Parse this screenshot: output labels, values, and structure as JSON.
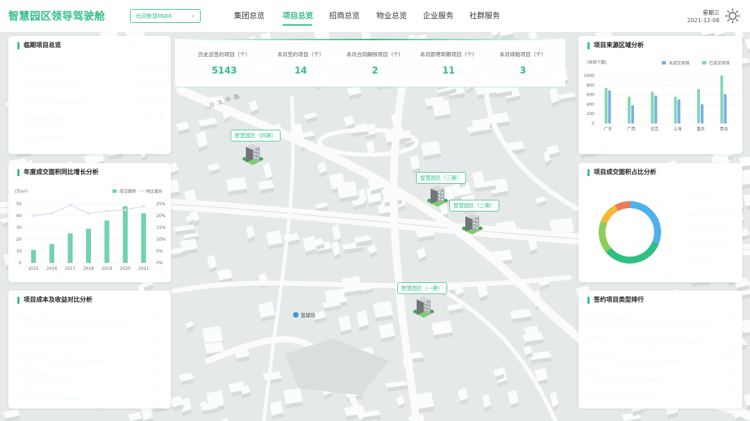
{
  "header": {
    "logo": "智慧园区领导驾驶舱",
    "park_select": "元间智慧PARK",
    "nav": [
      "集团总览",
      "项目总览",
      "招商总览",
      "物业总览",
      "企业服务",
      "社群服务"
    ],
    "nav_active_index": 1,
    "weekday": "星期三",
    "date": "2021-12-08"
  },
  "expiring": {
    "title": "临期项目总览",
    "items": [
      {
        "index": "1",
        "text": "进入意向协议阶段",
        "date": "2021-12-19"
      },
      {
        "index": "2",
        "text": "意向协议已签署，待审批",
        "date": "2021-12-21"
      },
      {
        "index": "3",
        "text": "二次回访，进入意向协议阶...",
        "date": "2021-12-30"
      },
      {
        "index": "4",
        "text": "进入意向协议阶段",
        "date": "2022-1-30"
      },
      {
        "index": "5",
        "text": "进入意向协议阶段",
        "date": "2022-2-14"
      }
    ]
  },
  "annual": {
    "title": "年度成交面积同比增长分析"
  },
  "cost": {
    "title": "项目成本及收益对比分析",
    "items": [
      {
        "name": "智慧园区（一期）",
        "value": "4242",
        "fill": 0.77
      },
      {
        "name": "智慧园区（二期）",
        "value": "3541",
        "fill": 0.47
      },
      {
        "name": "智慧园区（三期）",
        "value": "3894",
        "fill": 0.61
      },
      {
        "name": "智慧园区（四期）",
        "value": "3104",
        "fill": 0.35
      },
      {
        "name": "智慧园区（五期）",
        "value": "2765",
        "fill": 0.43
      }
    ]
  },
  "stats": [
    {
      "label": "历史总签约项目（个）",
      "value": "5143"
    },
    {
      "label": "本月签约项目（个）",
      "value": "14"
    },
    {
      "label": "本月合同解除项目（个）",
      "value": "2"
    },
    {
      "label": "本月即将到期项目（个）",
      "value": "11"
    },
    {
      "label": "本月续租项目（个）",
      "value": "3"
    }
  ],
  "map": {
    "road_name": "沙 太 中 路",
    "poi": "篮球场",
    "labels": [
      "智慧园区（四期）",
      "智慧园区（三期）",
      "智慧园区（二期）",
      "智慧园区（一期）"
    ]
  },
  "source": {
    "title": "项目来源区域分析"
  },
  "share": {
    "title": "项目成交面积占比分析"
  },
  "ranking": {
    "title": "签约项目类型排行",
    "items": [
      {
        "name": "软件与信息技术服务业",
        "value": "1532",
        "fill": 0.86
      },
      {
        "name": "生物医药",
        "value": "1412",
        "fill": 0.78
      },
      {
        "name": "文化创意产业",
        "value": "1105",
        "fill": 0.62
      },
      {
        "name": "时尚产业",
        "value": "897",
        "fill": 0.51
      },
      {
        "name": "数字经济",
        "value": "684",
        "fill": 0.43
      }
    ]
  },
  "chart_data": [
    {
      "type": "bar",
      "title": "年度成交面积同比增长分析",
      "ylabel": "(万m²)",
      "categories": [
        "2015",
        "2016",
        "2017",
        "2018",
        "2019",
        "2020",
        "2021"
      ],
      "series": [
        {
          "name": "成交面积",
          "type": "bar",
          "color": "#6fd3ab",
          "values": [
            11,
            16,
            25,
            29,
            36,
            48,
            42
          ]
        },
        {
          "name": "同比增长",
          "type": "line",
          "color": "#c7d4e6",
          "values": [
            20,
            21,
            24.5,
            21,
            22,
            22.5,
            24
          ]
        }
      ],
      "ylim": [
        0,
        50
      ],
      "yticks": [
        0,
        10,
        20,
        30,
        40,
        50
      ],
      "y2lim": [
        0,
        25
      ],
      "y2ticks": [
        "0%",
        "5%",
        "10%",
        "15%",
        "20%",
        "25%"
      ],
      "legend": "top-right"
    },
    {
      "type": "bar",
      "title": "项目来源区域分析",
      "ylabel": "(项目个数)",
      "categories": [
        "广东",
        "广西",
        "北京",
        "上海",
        "重庆",
        "青岛"
      ],
      "series": [
        {
          "name": "未成交项目",
          "color": "#7aaee6",
          "values": [
            690,
            380,
            580,
            500,
            400,
            610
          ]
        },
        {
          "name": "已成交项目",
          "color": "#7ed8b3",
          "values": [
            740,
            560,
            660,
            560,
            720,
            1000
          ]
        }
      ],
      "ylim": [
        0,
        1000
      ],
      "yticks": [
        0,
        200,
        400,
        600,
        800,
        1000
      ],
      "legend": "top-right"
    },
    {
      "type": "pie",
      "title": "项目成交面积占比分析",
      "labels": [
        ">2000㎡",
        "1500~2000㎡",
        "1000~1500㎡",
        "500~1000㎡",
        "<500㎡"
      ],
      "values": [
        31,
        33,
        17,
        11,
        8
      ],
      "colors": [
        "#4db1ea",
        "#2fbf84",
        "#8ccf58",
        "#f1b93a",
        "#ed7a59"
      ],
      "legend": "right"
    }
  ]
}
